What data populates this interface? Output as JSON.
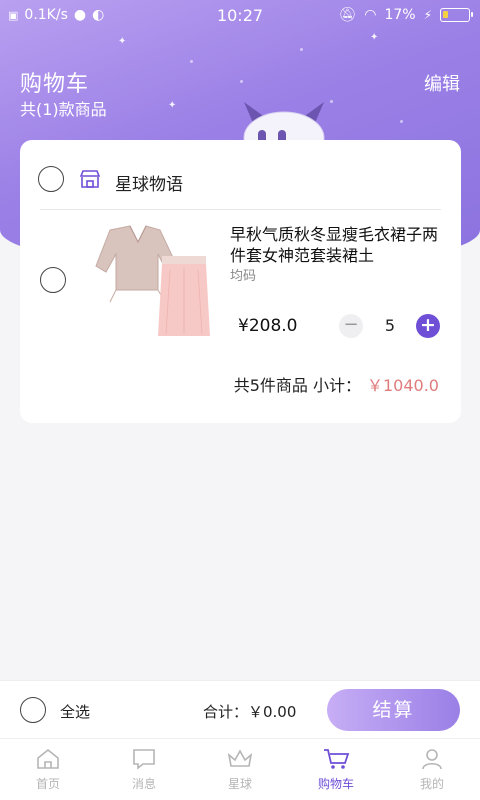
{
  "status_bar": {
    "speed": "0.1K/s",
    "time": "10:27",
    "battery": "17%"
  },
  "header": {
    "title": "购物车",
    "subtitle": "共(1)款商品",
    "edit_label": "编辑"
  },
  "cart": {
    "store_name": "星球物语",
    "item": {
      "title": "早秋气质秋冬显瘦毛衣裙子两件套女神范套装裙土",
      "spec": "均码",
      "price": "¥208.0",
      "quantity": "5",
      "qty_minus": "−",
      "qty_plus": "+"
    },
    "subtotal_label": "共5件商品  小计：",
    "subtotal_amount": "￥1040.0"
  },
  "checkout": {
    "select_all_label": "全选",
    "total_label": "合计：￥0.00",
    "checkout_label": "结算"
  },
  "tabs": [
    {
      "label": "首页",
      "icon": "home-icon"
    },
    {
      "label": "消息",
      "icon": "message-icon"
    },
    {
      "label": "星球",
      "icon": "crown-icon"
    },
    {
      "label": "购物车",
      "icon": "cart-icon",
      "active": true
    },
    {
      "label": "我的",
      "icon": "profile-icon"
    }
  ],
  "colors": {
    "accent": "#6f4fd6",
    "header_bg": "#9b80e6",
    "price_red": "#e07b7b"
  }
}
